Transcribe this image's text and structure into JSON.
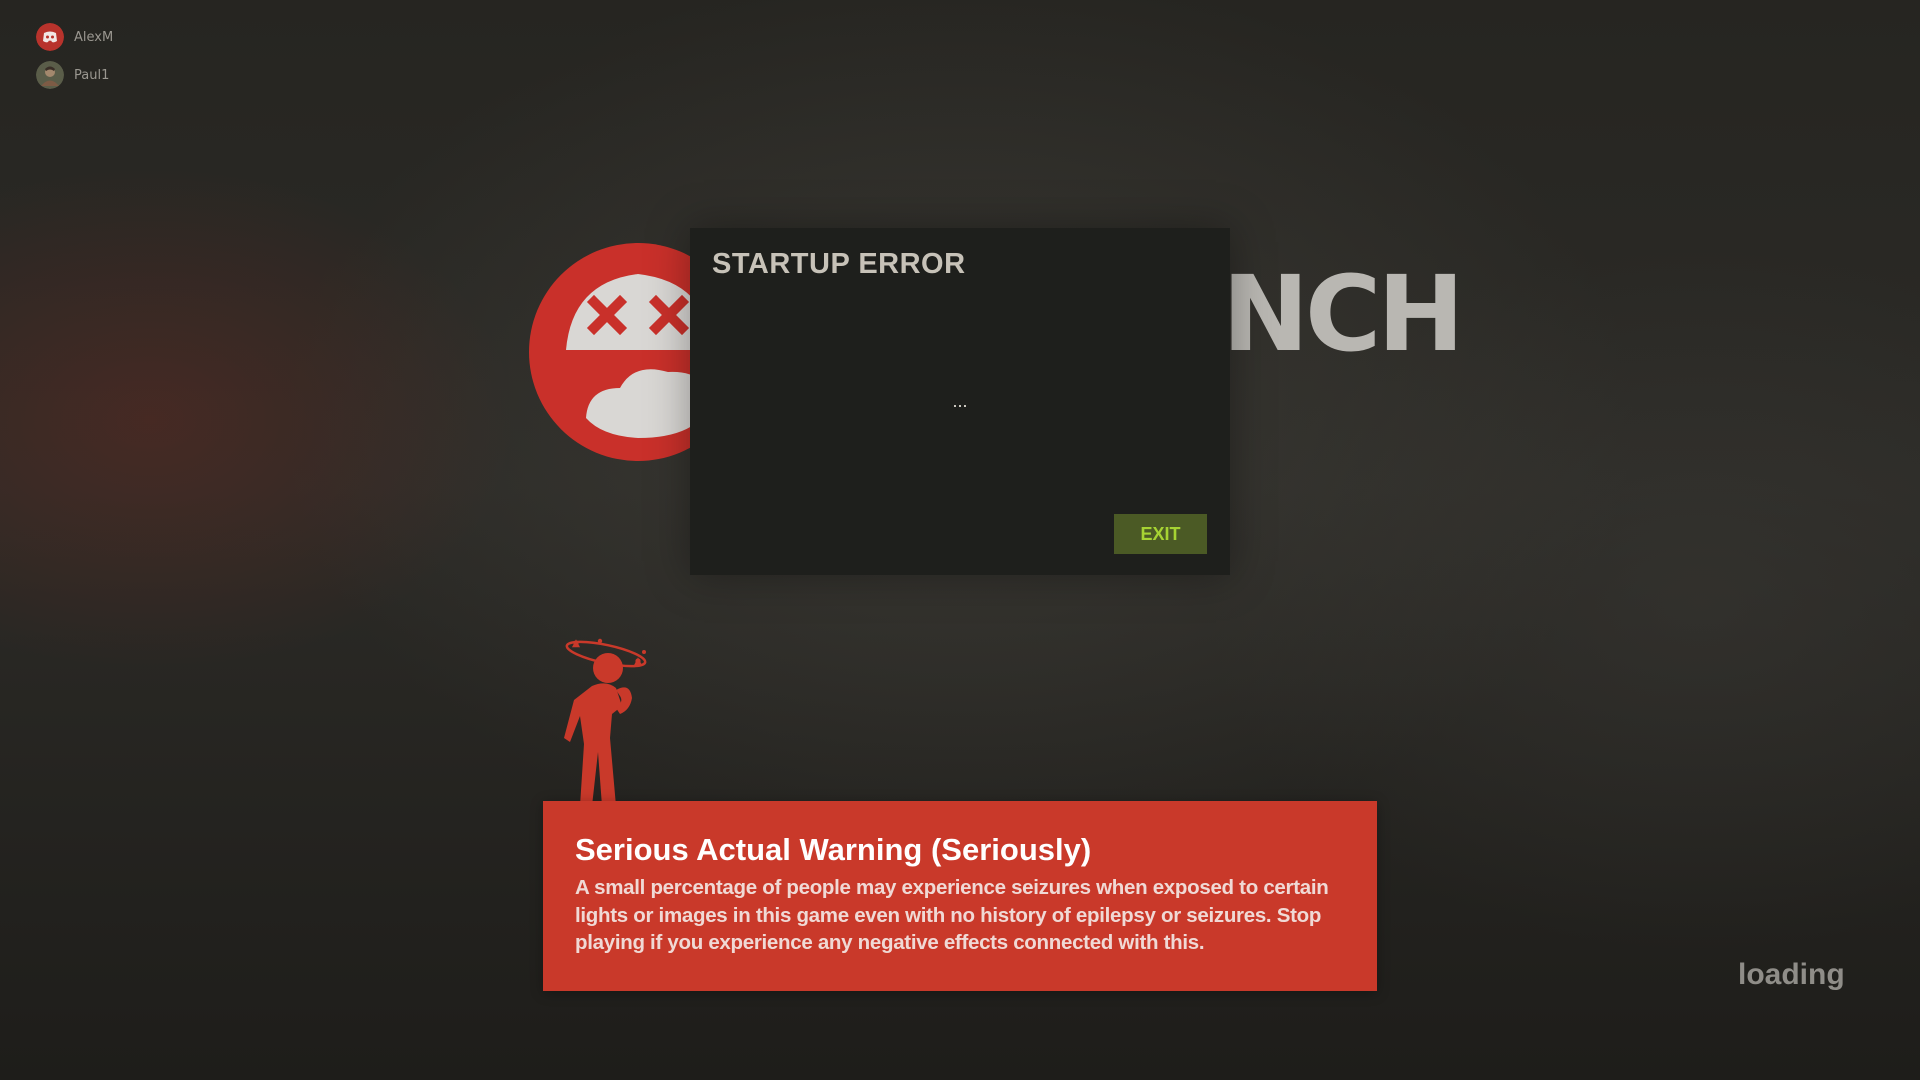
{
  "friends": [
    {
      "name": "AlexM",
      "avatar_icon": "discord-avatar-icon"
    },
    {
      "name": "Paul1",
      "avatar_icon": "user-avatar-icon"
    }
  ],
  "logo": {
    "emblem_icon": "dead-face-logo-icon",
    "visible_text": "NCH"
  },
  "dialog": {
    "title": "STARTUP ERROR",
    "message": "...",
    "exit_label": "EXIT"
  },
  "warning": {
    "figure_icon": "dizzy-person-icon",
    "title": "Serious Actual Warning (Seriously)",
    "body": "A small percentage of people may experience seizures when exposed to certain lights or images in this game even with no history of epilepsy or seizures. Stop playing if you experience any negative effects connected with this."
  },
  "status": {
    "loading": "loading"
  },
  "colors": {
    "warning_red": "#c9392a",
    "exit_button_bg": "#4b5a25",
    "exit_button_text": "#a6d333",
    "logo_red": "#c9302a",
    "dialog_bg": "#1e1f1c"
  }
}
